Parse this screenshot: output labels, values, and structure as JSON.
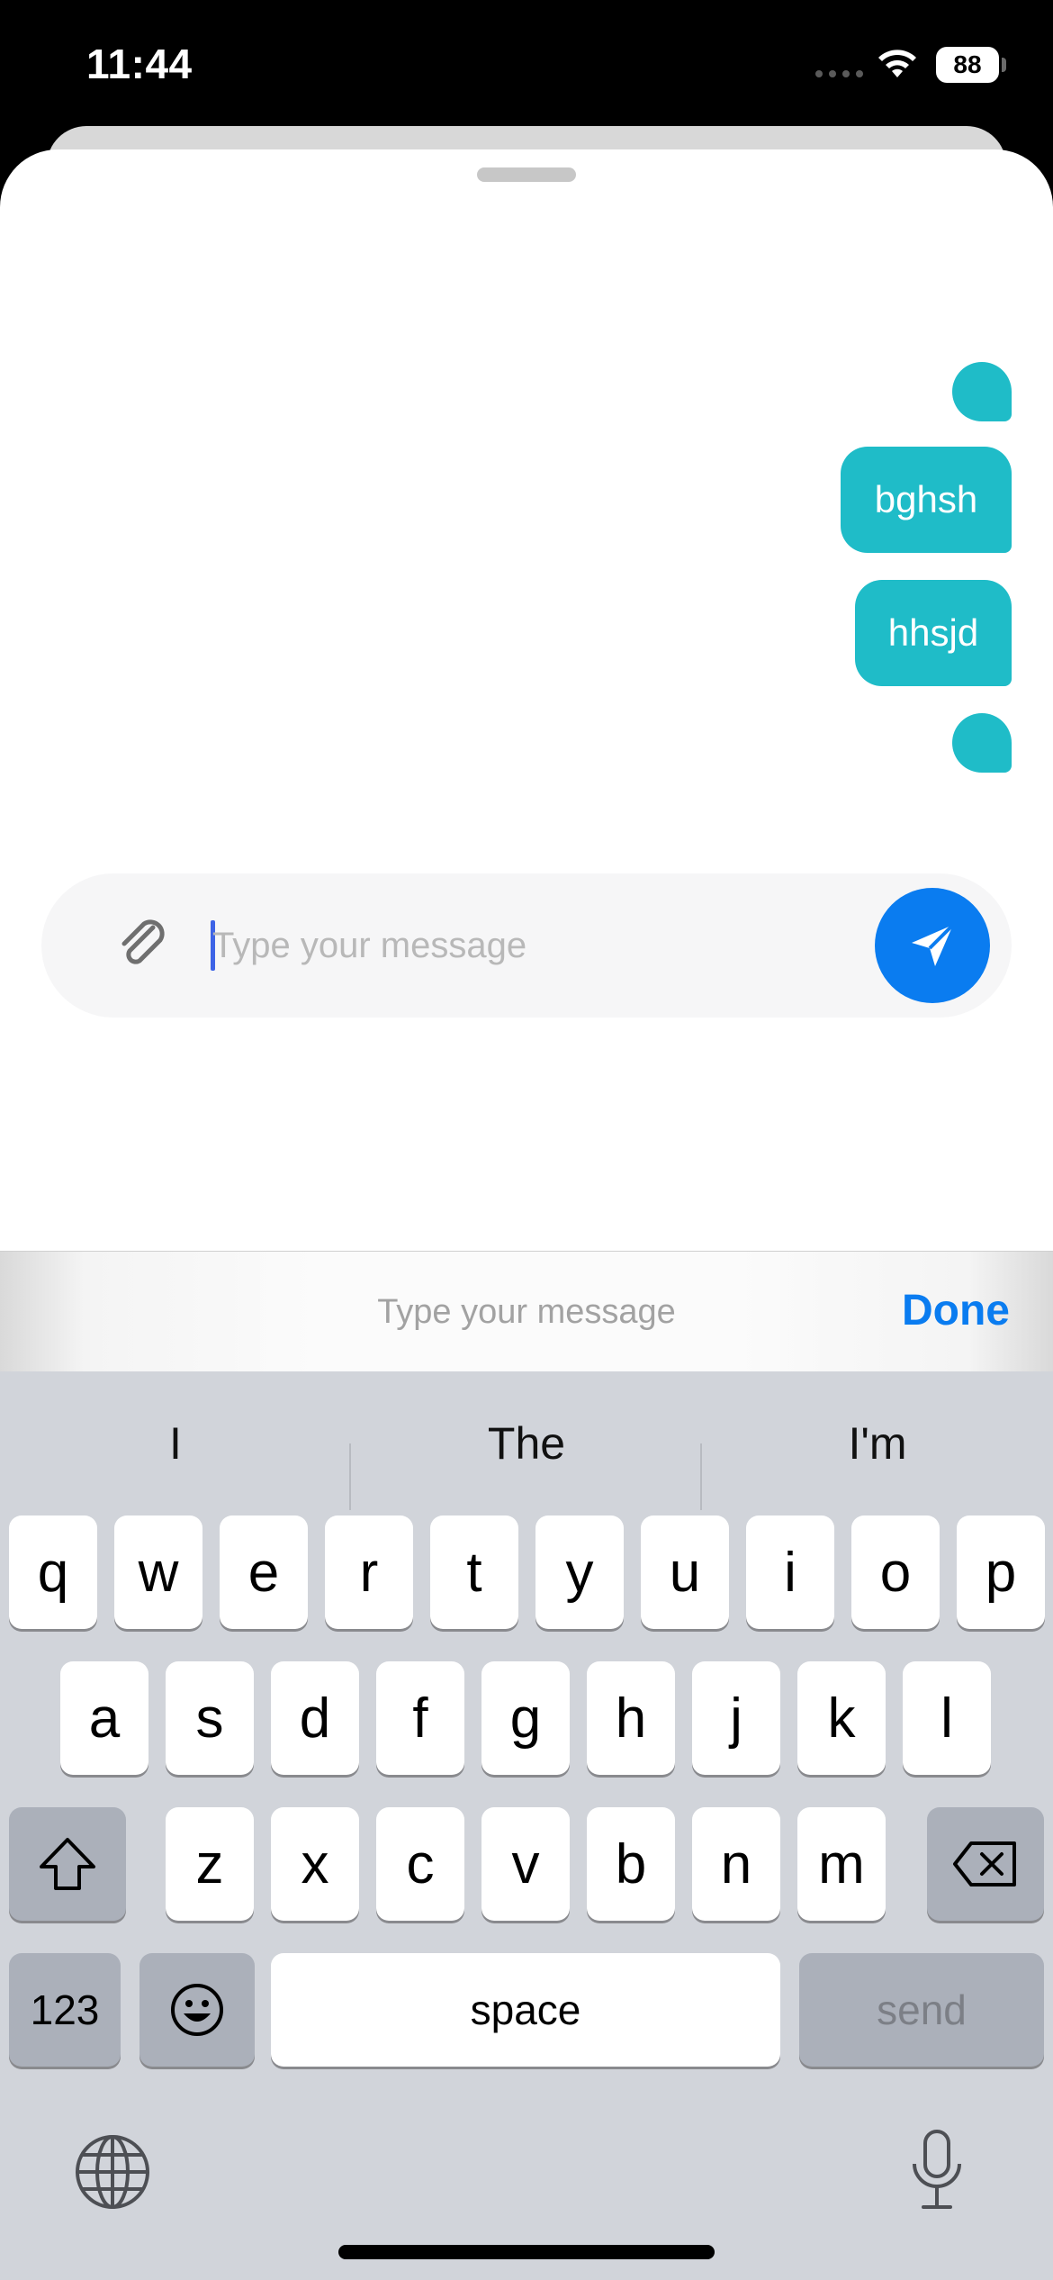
{
  "status_bar": {
    "time": "11:44",
    "battery": "88"
  },
  "messages": [
    {
      "text": ""
    },
    {
      "text": "bghsh"
    },
    {
      "text": "hhsjd"
    },
    {
      "text": ""
    }
  ],
  "composer": {
    "placeholder": "Type your message",
    "value": ""
  },
  "accessory": {
    "title": "Type your message",
    "done_label": "Done"
  },
  "keyboard": {
    "suggestions": [
      "I",
      "The",
      "I'm"
    ],
    "row1": [
      "q",
      "w",
      "e",
      "r",
      "t",
      "y",
      "u",
      "i",
      "o",
      "p"
    ],
    "row2": [
      "a",
      "s",
      "d",
      "f",
      "g",
      "h",
      "j",
      "k",
      "l"
    ],
    "row3": [
      "z",
      "x",
      "c",
      "v",
      "b",
      "n",
      "m"
    ],
    "numbers_label": "123",
    "space_label": "space",
    "send_label": "send"
  },
  "colors": {
    "bubble": "#1fbcc8",
    "accent": "#0a7cf0"
  },
  "icons": [
    "wifi-icon",
    "paperclip-icon",
    "send-arrow-icon",
    "shift-icon",
    "delete-icon",
    "emoji-icon",
    "globe-icon",
    "microphone-icon"
  ]
}
